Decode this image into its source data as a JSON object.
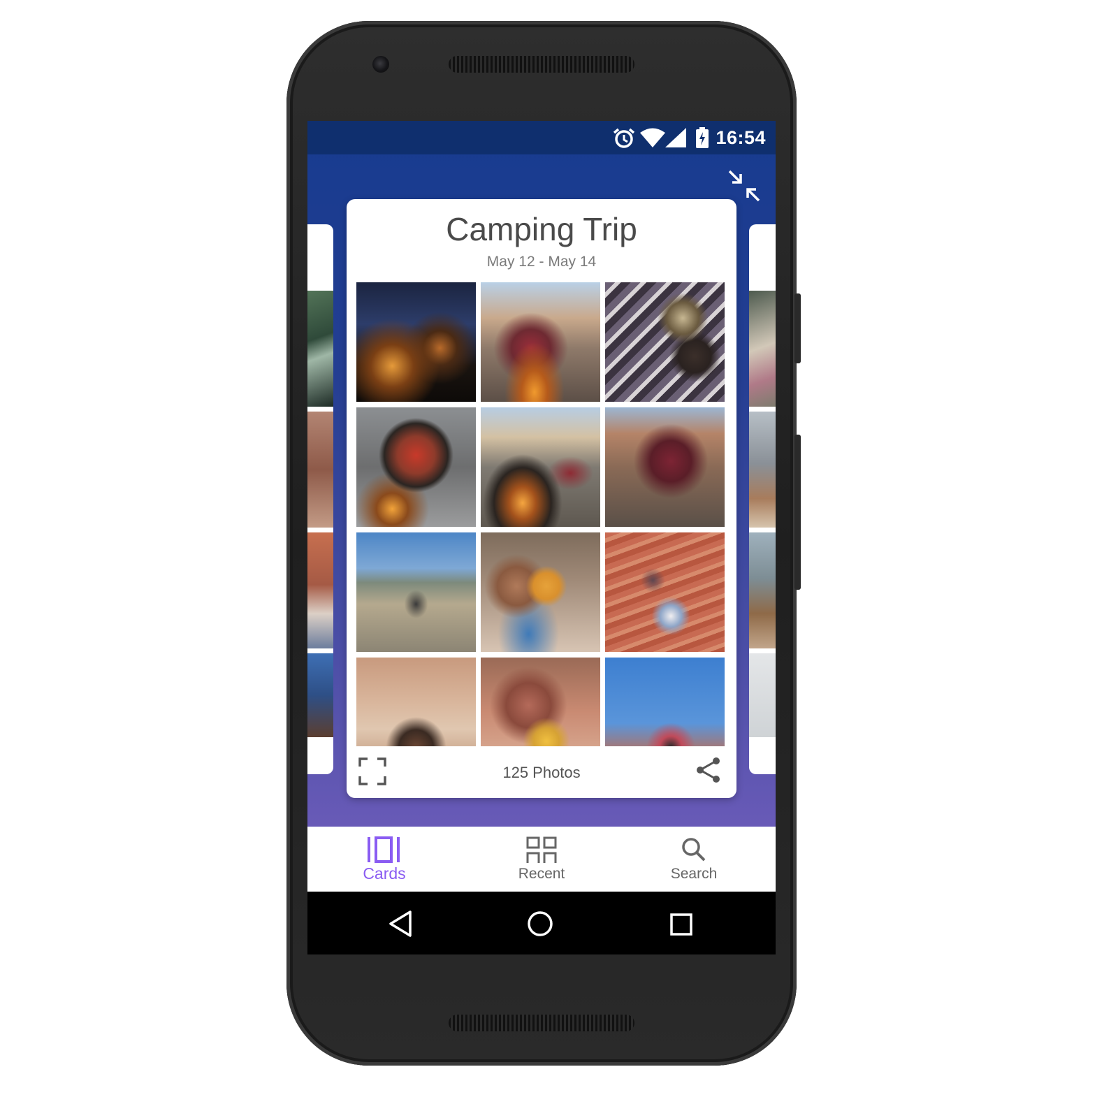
{
  "status_bar": {
    "time": "16:54",
    "icons": [
      "alarm-icon",
      "wifi-icon",
      "cell-signal-icon",
      "battery-charging-icon"
    ]
  },
  "toolbar": {
    "collapse_icon": "collapse-icon"
  },
  "album_card": {
    "title": "Camping Trip",
    "date_range": "May 12 - May 14",
    "photo_count": "125 Photos",
    "expand_icon": "fullscreen-icon",
    "share_icon": "share-icon"
  },
  "bottom_nav": {
    "items": [
      {
        "label": "Cards",
        "icon": "cards-icon",
        "active": true
      },
      {
        "label": "Recent",
        "icon": "grid-icon",
        "active": false
      },
      {
        "label": "Search",
        "icon": "search-icon",
        "active": false
      }
    ]
  },
  "system_nav": [
    "back-icon",
    "home-icon",
    "recents-icon"
  ],
  "colors": {
    "accent": "#8a5cf2",
    "status_bar": "#0f2f6e",
    "gradient_top": "#173b8f",
    "gradient_bottom": "#7e63c4"
  }
}
